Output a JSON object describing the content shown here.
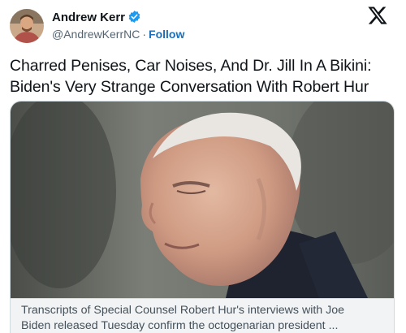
{
  "post": {
    "author": {
      "name": "Andrew Kerr",
      "handle": "@AndrewKerrNC",
      "separator": "·",
      "follow_label": "Follow",
      "avatar_icon": "avatar-photo",
      "verified_icon": "verified-badge-icon",
      "verified_color": "#1d9bf0"
    },
    "platform_icon": "x-logo-icon",
    "headline": "Charred Penises, Car Noises, And Dr. Jill In A Bikini: Biden's Very Strange Conversation With Robert Hur",
    "link_card": {
      "image_icon": "article-photo",
      "caption_line1": "Transcripts of Special Counsel Robert Hur's interviews with Joe",
      "caption_line2": "Biden released Tuesday confirm the octogenarian president ..."
    }
  },
  "colors": {
    "text": "#0f1419",
    "secondary": "#536471",
    "follow": "#1d6fb8",
    "border": "#cfd9de"
  }
}
